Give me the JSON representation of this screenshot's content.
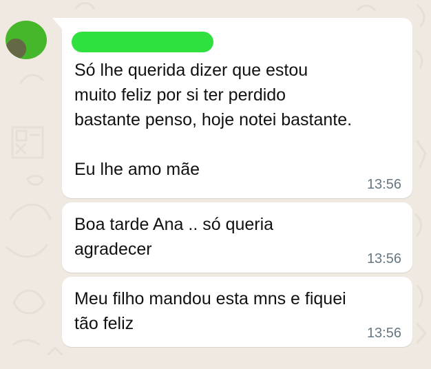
{
  "colors": {
    "wallpaper": "#efe9e1",
    "bubble": "#ffffff",
    "sender_redaction": "#2fe03f",
    "avatar_redaction": "#46b62b",
    "timestamp": "#667781"
  },
  "messages": [
    {
      "text": "Só lhe querida dizer que estou\nmuito feliz por si ter perdido\nbastante penso, hoje notei bastante.\n\nEu lhe amo mãe",
      "time": "13:56"
    },
    {
      "text": "Boa tarde Ana .. só queria\nagradecer",
      "time": "13:56"
    },
    {
      "text": "Meu filho mandou esta mns e fiquei\ntão feliz",
      "time": "13:56"
    }
  ]
}
